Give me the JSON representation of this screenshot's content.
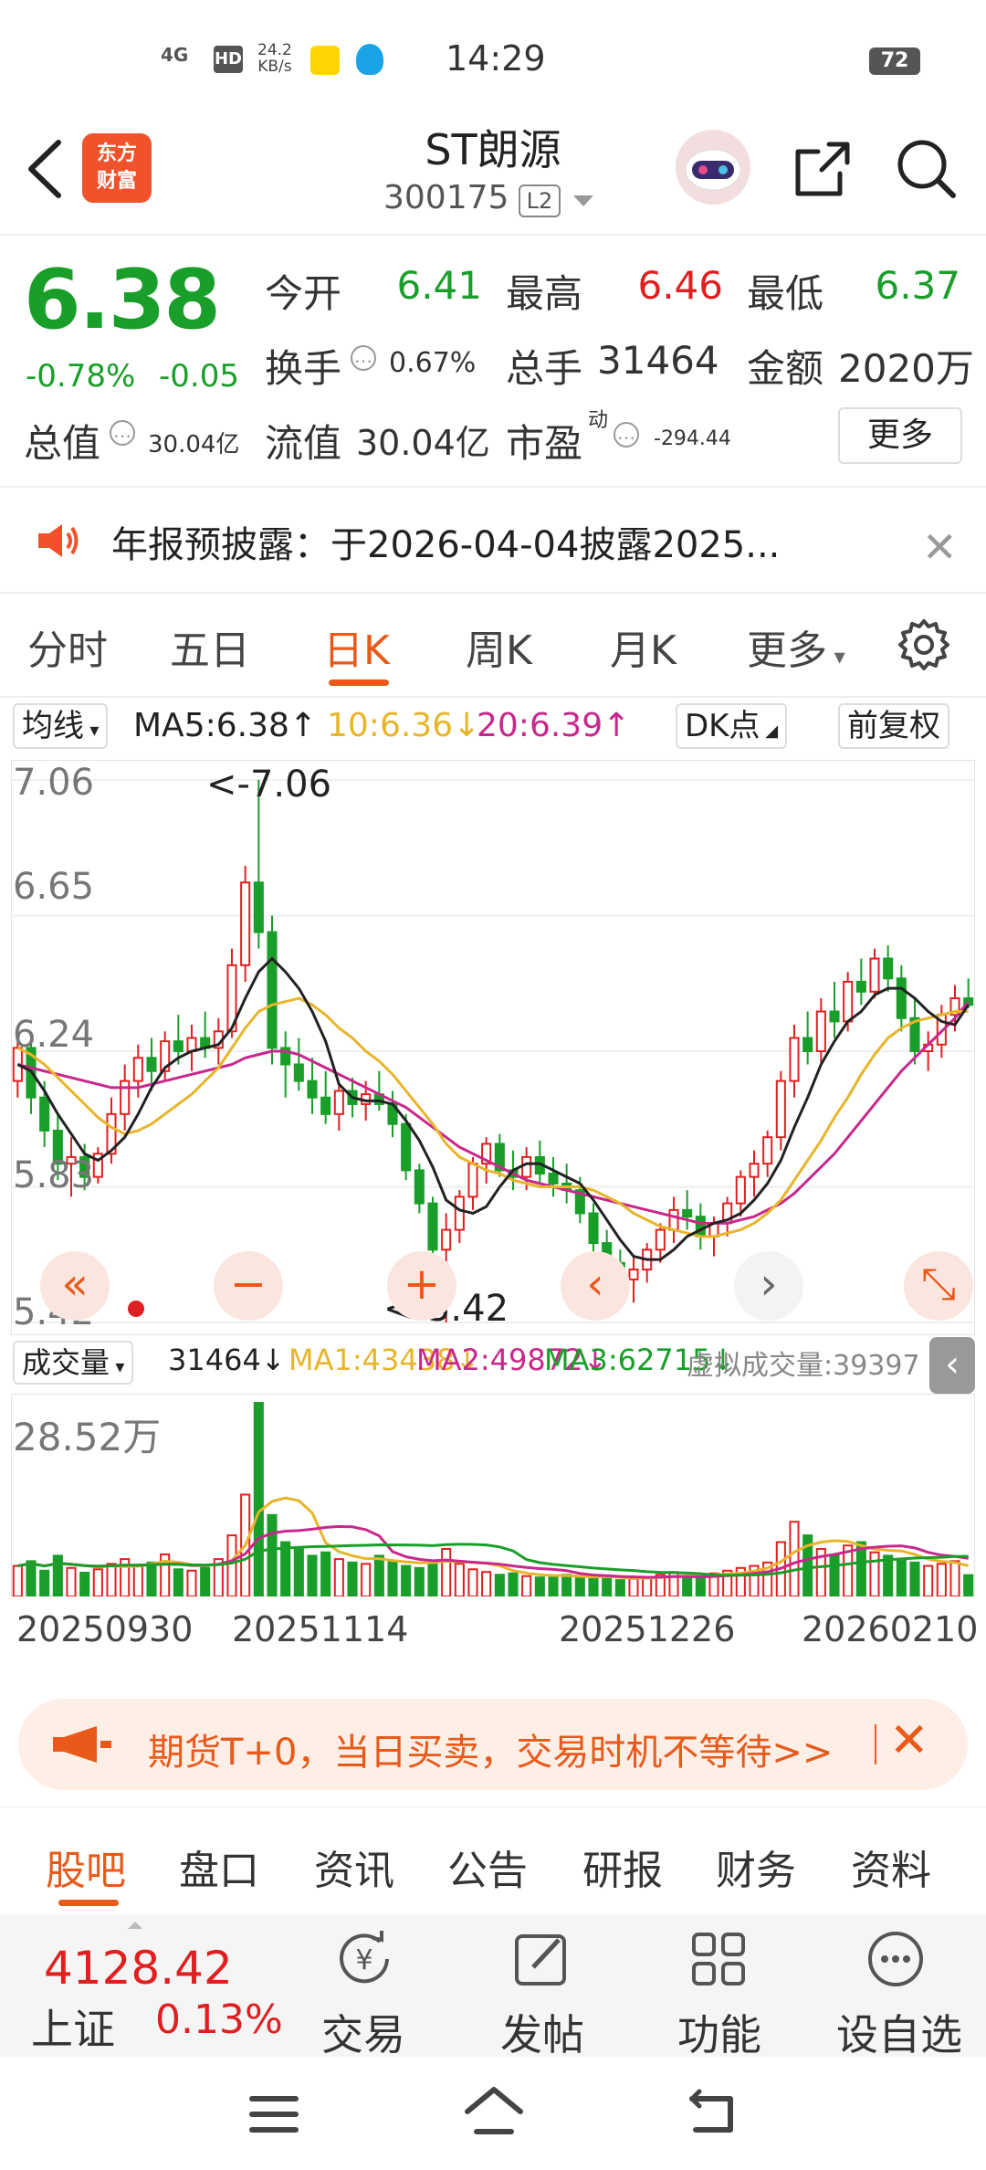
{
  "status_bar": {
    "time": "14:29",
    "network": "4G",
    "hd": "HD",
    "speed_top": "24.2",
    "speed_bottom": "KB/s",
    "battery": "72"
  },
  "header": {
    "logo_line1": "东方",
    "logo_line2": "财富",
    "title": "ST朗源",
    "code": "300175",
    "level": "L2"
  },
  "quote": {
    "price": "6.38",
    "change_pct": "-0.78%",
    "change": "-0.05",
    "open_label": "今开",
    "open": "6.41",
    "high_label": "最高",
    "high": "6.46",
    "low_label": "最低",
    "low": "6.37",
    "turnover_label": "换手",
    "turnover": "0.67%",
    "volume_label": "总手",
    "volume": "31464",
    "amount_label": "金额",
    "amount": "2020万",
    "mktcap_label": "总值",
    "mktcap": "30.04亿",
    "float_label": "流值",
    "float": "30.04亿",
    "pe_label": "市盈",
    "pe_sup": "动",
    "pe": "-294.44",
    "more": "更多"
  },
  "notice": {
    "text": "年报预披露：于2026-04-04披露2025..."
  },
  "kline_tabs": [
    "分时",
    "五日",
    "日K",
    "周K",
    "月K",
    "更多"
  ],
  "kline_active": "日K",
  "indicator_row": {
    "ma_select": "均线",
    "ma5": "MA5:6.38↑",
    "ma10": "10:6.36↓",
    "ma20": "20:6.39↑",
    "dk": "DK点",
    "adjust": "前复权"
  },
  "colors": {
    "up": "#e02020",
    "down": "#1a9e2a",
    "ma5": "#222222",
    "ma10": "#e8b52a",
    "ma20": "#c8288c",
    "accent": "#e85a1a"
  },
  "chart_data": [
    {
      "type": "candlestick",
      "title": "",
      "y_ticks": [
        "7.06",
        "6.65",
        "6.24",
        "5.83",
        "5.42"
      ],
      "ylim": [
        5.42,
        7.06
      ],
      "max_marker": "<-7.06",
      "min_marker": "<-5.42",
      "x_ticks": [
        "20250930",
        "20251114",
        "20251226",
        "20260210"
      ],
      "ohlc": [
        [
          6.15,
          6.3,
          6.1,
          6.25
        ],
        [
          6.25,
          6.27,
          6.05,
          6.1
        ],
        [
          6.1,
          6.15,
          5.95,
          6.0
        ],
        [
          6.0,
          6.05,
          5.85,
          5.9
        ],
        [
          5.9,
          5.98,
          5.8,
          5.92
        ],
        [
          5.92,
          5.96,
          5.82,
          5.86
        ],
        [
          5.86,
          5.95,
          5.84,
          5.93
        ],
        [
          5.93,
          6.1,
          5.9,
          6.05
        ],
        [
          6.05,
          6.2,
          6.0,
          6.15
        ],
        [
          6.15,
          6.26,
          6.1,
          6.22
        ],
        [
          6.22,
          6.28,
          6.12,
          6.18
        ],
        [
          6.18,
          6.3,
          6.15,
          6.27
        ],
        [
          6.27,
          6.35,
          6.2,
          6.24
        ],
        [
          6.24,
          6.32,
          6.18,
          6.28
        ],
        [
          6.28,
          6.36,
          6.22,
          6.25
        ],
        [
          6.25,
          6.34,
          6.2,
          6.3
        ],
        [
          6.3,
          6.55,
          6.28,
          6.5
        ],
        [
          6.5,
          6.8,
          6.45,
          6.75
        ],
        [
          6.75,
          7.06,
          6.55,
          6.6
        ],
        [
          6.6,
          6.65,
          6.2,
          6.25
        ],
        [
          6.25,
          6.3,
          6.1,
          6.2
        ],
        [
          6.2,
          6.28,
          6.12,
          6.15
        ],
        [
          6.15,
          6.22,
          6.05,
          6.1
        ],
        [
          6.1,
          6.18,
          6.02,
          6.05
        ],
        [
          6.05,
          6.14,
          6.0,
          6.12
        ],
        [
          6.12,
          6.16,
          6.04,
          6.08
        ],
        [
          6.08,
          6.15,
          6.03,
          6.11
        ],
        [
          6.11,
          6.18,
          6.06,
          6.08
        ],
        [
          6.08,
          6.12,
          5.98,
          6.02
        ],
        [
          6.02,
          6.05,
          5.85,
          5.88
        ],
        [
          5.88,
          5.9,
          5.75,
          5.78
        ],
        [
          5.78,
          5.8,
          5.6,
          5.64
        ],
        [
          5.64,
          5.75,
          5.42,
          5.7
        ],
        [
          5.7,
          5.82,
          5.66,
          5.8
        ],
        [
          5.8,
          5.92,
          5.76,
          5.9
        ],
        [
          5.9,
          5.98,
          5.84,
          5.96
        ],
        [
          5.96,
          5.99,
          5.86,
          5.88
        ],
        [
          5.88,
          5.94,
          5.82,
          5.86
        ],
        [
          5.86,
          5.95,
          5.82,
          5.92
        ],
        [
          5.92,
          5.97,
          5.84,
          5.87
        ],
        [
          5.87,
          5.92,
          5.8,
          5.84
        ],
        [
          5.84,
          5.9,
          5.78,
          5.82
        ],
        [
          5.82,
          5.86,
          5.72,
          5.75
        ],
        [
          5.75,
          5.78,
          5.62,
          5.66
        ],
        [
          5.66,
          5.7,
          5.56,
          5.6
        ],
        [
          5.6,
          5.64,
          5.5,
          5.55
        ],
        [
          5.55,
          5.62,
          5.48,
          5.58
        ],
        [
          5.58,
          5.66,
          5.54,
          5.64
        ],
        [
          5.64,
          5.72,
          5.6,
          5.7
        ],
        [
          5.7,
          5.8,
          5.66,
          5.76
        ],
        [
          5.76,
          5.82,
          5.7,
          5.74
        ],
        [
          5.74,
          5.78,
          5.64,
          5.68
        ],
        [
          5.68,
          5.74,
          5.62,
          5.72
        ],
        [
          5.72,
          5.8,
          5.68,
          5.78
        ],
        [
          5.78,
          5.88,
          5.74,
          5.86
        ],
        [
          5.86,
          5.94,
          5.8,
          5.9
        ],
        [
          5.9,
          6.0,
          5.86,
          5.98
        ],
        [
          5.98,
          6.18,
          5.94,
          6.15
        ],
        [
          6.15,
          6.32,
          6.1,
          6.28
        ],
        [
          6.28,
          6.36,
          6.2,
          6.24
        ],
        [
          6.24,
          6.4,
          6.2,
          6.36
        ],
        [
          6.36,
          6.45,
          6.28,
          6.33
        ],
        [
          6.33,
          6.48,
          6.3,
          6.45
        ],
        [
          6.45,
          6.52,
          6.38,
          6.42
        ],
        [
          6.42,
          6.55,
          6.4,
          6.52
        ],
        [
          6.52,
          6.56,
          6.42,
          6.46
        ],
        [
          6.46,
          6.5,
          6.3,
          6.34
        ],
        [
          6.34,
          6.4,
          6.2,
          6.24
        ],
        [
          6.24,
          6.3,
          6.18,
          6.26
        ],
        [
          6.26,
          6.38,
          6.22,
          6.35
        ],
        [
          6.35,
          6.44,
          6.3,
          6.4
        ],
        [
          6.4,
          6.46,
          6.37,
          6.38
        ]
      ],
      "ma5": [
        6.2,
        6.18,
        6.12,
        6.05,
        5.99,
        5.93,
        5.91,
        5.94,
        5.98,
        6.05,
        6.13,
        6.19,
        6.22,
        6.24,
        6.25,
        6.26,
        6.31,
        6.4,
        6.48,
        6.52,
        6.48,
        6.43,
        6.36,
        6.27,
        6.14,
        6.1,
        6.09,
        6.09,
        6.08,
        6.03,
        5.97,
        5.89,
        5.79,
        5.76,
        5.75,
        5.77,
        5.83,
        5.88,
        5.9,
        5.9,
        5.88,
        5.86,
        5.84,
        5.79,
        5.73,
        5.67,
        5.62,
        5.61,
        5.61,
        5.64,
        5.68,
        5.7,
        5.72,
        5.73,
        5.75,
        5.79,
        5.84,
        5.91,
        6.01,
        6.1,
        6.2,
        6.27,
        6.33,
        6.36,
        6.41,
        6.43,
        6.43,
        6.4,
        6.36,
        6.33,
        6.32,
        6.38
      ],
      "ma10": [
        6.25,
        6.23,
        6.2,
        6.16,
        6.12,
        6.08,
        6.04,
        6.01,
        5.99,
        6.0,
        6.02,
        6.05,
        6.08,
        6.11,
        6.15,
        6.19,
        6.25,
        6.31,
        6.36,
        6.38,
        6.39,
        6.4,
        6.38,
        6.35,
        6.31,
        6.28,
        6.24,
        6.21,
        6.17,
        6.12,
        6.07,
        6.02,
        5.96,
        5.92,
        5.9,
        5.88,
        5.87,
        5.85,
        5.84,
        5.83,
        5.83,
        5.83,
        5.83,
        5.82,
        5.8,
        5.78,
        5.75,
        5.73,
        5.71,
        5.7,
        5.69,
        5.68,
        5.68,
        5.69,
        5.7,
        5.72,
        5.75,
        5.79,
        5.85,
        5.91,
        5.97,
        6.04,
        6.1,
        6.17,
        6.23,
        6.28,
        6.31,
        6.33,
        6.34,
        6.35,
        6.36,
        6.36
      ],
      "ma20": [
        6.2,
        6.19,
        6.18,
        6.17,
        6.16,
        6.15,
        6.14,
        6.13,
        6.13,
        6.13,
        6.14,
        6.15,
        6.16,
        6.17,
        6.18,
        6.19,
        6.2,
        6.22,
        6.23,
        6.24,
        6.24,
        6.23,
        6.21,
        6.19,
        6.17,
        6.15,
        6.13,
        6.11,
        6.09,
        6.07,
        6.04,
        6.01,
        5.98,
        5.95,
        5.93,
        5.91,
        5.89,
        5.87,
        5.85,
        5.84,
        5.83,
        5.82,
        5.81,
        5.8,
        5.79,
        5.78,
        5.77,
        5.76,
        5.75,
        5.74,
        5.73,
        5.72,
        5.72,
        5.72,
        5.73,
        5.74,
        5.76,
        5.78,
        5.81,
        5.85,
        5.89,
        5.93,
        5.98,
        6.03,
        6.08,
        6.13,
        6.18,
        6.22,
        6.26,
        6.3,
        6.34,
        6.39
      ]
    },
    {
      "type": "bar",
      "title": "成交量",
      "ymax_label": "28.52万",
      "ylim": [
        0,
        285200
      ],
      "volumes": [
        45000,
        52000,
        38000,
        60000,
        42000,
        35000,
        40000,
        48000,
        55000,
        45000,
        50000,
        62000,
        40000,
        38000,
        42000,
        55000,
        90000,
        150000,
        285200,
        120000,
        80000,
        70000,
        60000,
        65000,
        55000,
        50000,
        48000,
        60000,
        52000,
        45000,
        42000,
        50000,
        70000,
        48000,
        40000,
        36000,
        32000,
        34000,
        30000,
        28000,
        30000,
        32000,
        28000,
        26000,
        30000,
        24000,
        26000,
        28000,
        32000,
        36000,
        30000,
        28000,
        34000,
        38000,
        42000,
        45000,
        50000,
        80000,
        110000,
        90000,
        70000,
        60000,
        75000,
        80000,
        65000,
        60000,
        55000,
        50000,
        45000,
        48000,
        52000,
        31464
      ]
    }
  ],
  "volume_row": {
    "select": "成交量",
    "vol": "31464↓",
    "ma1": "MA1:43438↓",
    "ma2": "MA2:49872↓",
    "ma3": "MA3:62715↓",
    "virtual": "虚拟成交量:39397"
  },
  "ad": {
    "text": "期货T+0，当日买卖，交易时机不等待>>"
  },
  "bottom_tabs": [
    "股吧",
    "盘口",
    "资讯",
    "公告",
    "研报",
    "财务",
    "资料"
  ],
  "dock": {
    "index_value": "4128.42",
    "index_name": "上证",
    "index_pct": "0.13%",
    "items": [
      {
        "label": "交易",
        "icon": "yen-cycle-icon"
      },
      {
        "label": "发帖",
        "icon": "edit-icon"
      },
      {
        "label": "功能",
        "icon": "grid-icon"
      },
      {
        "label": "设自选",
        "icon": "more-dots-icon"
      }
    ]
  }
}
